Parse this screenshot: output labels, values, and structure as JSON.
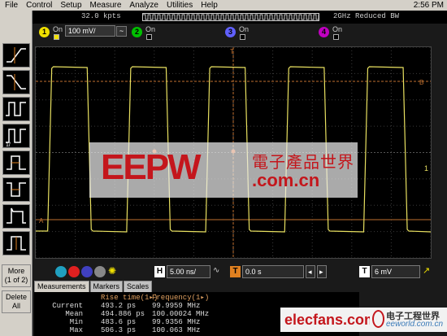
{
  "menu": {
    "items": [
      "File",
      "Control",
      "Setup",
      "Measure",
      "Analyze",
      "Utilities",
      "Help"
    ],
    "clock": "2:56 PM"
  },
  "acquisition": {
    "points": "32.0 kpts",
    "bandwidth": "2GHz Reduced BW"
  },
  "channels": [
    {
      "num": "1",
      "on_label": "On",
      "scale": "100 mV/",
      "color": "#f0e000"
    },
    {
      "num": "2",
      "on_label": "On",
      "color": "#00c000"
    },
    {
      "num": "3",
      "on_label": "On",
      "color": "#6060ff"
    },
    {
      "num": "4",
      "on_label": "On",
      "color": "#c000c0"
    }
  ],
  "side": {
    "more": "More",
    "page": "(1 of 2)",
    "delete_all": "Delete All"
  },
  "grid_markers": {
    "marker_a": "A",
    "marker_b": "B",
    "trigger_label": "T",
    "ch1_marker": "1"
  },
  "timebase": {
    "label": "H",
    "scale": "5.00 ns/",
    "delay_label": "T",
    "delay": "0.0 s",
    "trigger_label": "T",
    "trigger_level": "6 mV"
  },
  "tabs": [
    "Measurements",
    "Markers",
    "Scales"
  ],
  "measurements": {
    "col1_header": "Rise time(1▸)",
    "col2_header": "Frequency(1▸)",
    "rows": [
      {
        "label": "Current",
        "rise": "493.2 ps",
        "freq": "99.9959 MHz"
      },
      {
        "label": "Mean",
        "rise": "494.886 ps",
        "freq": "100.00024 MHz"
      },
      {
        "label": "Min",
        "rise": "483.6 ps",
        "freq": "99.9356 MHz"
      },
      {
        "label": "Max",
        "rise": "506.3 ps",
        "freq": "100.063 MHz"
      }
    ]
  },
  "watermarks": {
    "eepw": "EEPW",
    "eepw_cn": "電子產品世界",
    "eepw_com": ".com.cn",
    "elecfans": "elecfans.com",
    "eeworld_cn": "电子工程世界",
    "eeworld_en": "eeworld.com.cn"
  },
  "waveform": {
    "frequency_mhz": 100,
    "timebase_ns_per_div": 5.0,
    "vertical_mv_per_div": 100,
    "color": "#e8e060"
  }
}
